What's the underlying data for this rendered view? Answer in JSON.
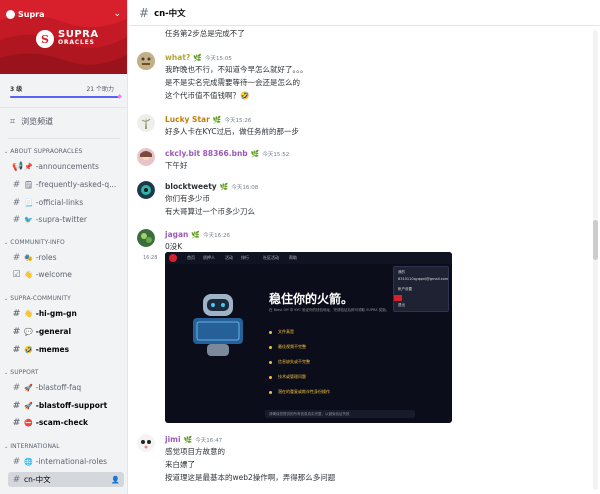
{
  "server": {
    "name": "Supra",
    "logo_main": "SUPRA",
    "logo_sub": "ORACLES",
    "logo_mark": "S",
    "boost_level": "3 级",
    "boost_count": "21 个助力",
    "boost_progress": 1.0,
    "accent": "#d8202c"
  },
  "browse": {
    "label": "浏览频道"
  },
  "categories": {
    "about": "ABOUT SUPRAORACLES",
    "community_info": "COMMUNITY-INFO",
    "supra_community": "SUPRA-COMMUNITY",
    "support": "SUPPORT",
    "international": "INTERNATIONAL"
  },
  "channels": {
    "announcements": "-announcements",
    "faq": "-frequently-asked-q...",
    "official_links": "-official-links",
    "twitter": "-supra-twitter",
    "roles": "-roles",
    "welcome": "-welcome",
    "hi_gm_gn": "-hi-gm-gn",
    "general": "-general",
    "memes": "-memes",
    "blastoff_faq": "-blastoff-faq",
    "blastoff_support": "-blastoff-support",
    "scam_check": "-scam-check",
    "international_roles": "-international-roles",
    "cn": "cn-中文"
  },
  "topbar": {
    "channel": "cn-中文"
  },
  "messages": {
    "m0": {
      "l1": "任务第2步总是完成不了"
    },
    "m1": {
      "author": "what?",
      "ts": "今天15:05",
      "color": "#b3a43b",
      "l1": "我昨晚也不行，不知道今早怎么就好了。。。",
      "l2": "是不是实名完成需要等待一会还是怎么的",
      "l3": "这个代币值不值钱啊？🤣"
    },
    "m2": {
      "author": "Lucky Star",
      "ts": "今天15:26",
      "color": "#c27c0e",
      "l1": "好多人卡在KYC过后，做任务前的那一步"
    },
    "m3": {
      "author": "ckcly.bit 88366.bnb",
      "ts": "今天15:52",
      "color": "#9b59b6",
      "l1": "下午好"
    },
    "m4": {
      "author": "blocktweety",
      "ts": "今天16:08",
      "color": "#2e3338",
      "l1": "你们有多少币",
      "l2": "有大哥算过一个币多少刀么"
    },
    "m5": {
      "author": "jagan",
      "ts": "今天16:26",
      "color": "#9b59b6",
      "l1": "0没K",
      "cont_ts": "16:28"
    },
    "m6": {
      "author": "jimi",
      "ts": "今天16:47",
      "color": "#9b59b6",
      "l1": "感觉项目方故意的",
      "l2": "来白嫖了",
      "l3": "按道理这是最基本的web2操作啊，弄得那么多问题"
    }
  },
  "embed": {
    "nav": [
      "首页",
      "质押人",
      "活动",
      "排行",
      "社区活动",
      "帮助"
    ],
    "acct_title": "我的",
    "acct_email": "8310110qyqqelj@gmail.com",
    "acct_l3": "帐户设置",
    "acct_l4": "退出",
    "heading": "稳住你的火箭。",
    "sub": "在 Blast Off 中 KYC 验证你的钱包地址，完成验证后即可领取 SUPRA 奖励。",
    "bullets": [
      "文件真是",
      "最佳视频不完整",
      "信息缺失或不完整",
      "技术或管理问题",
      "潜在的重复或欺诈性身份操作"
    ],
    "footer": "请确保您提供的所有信息真实完整，以避免验证失败"
  }
}
